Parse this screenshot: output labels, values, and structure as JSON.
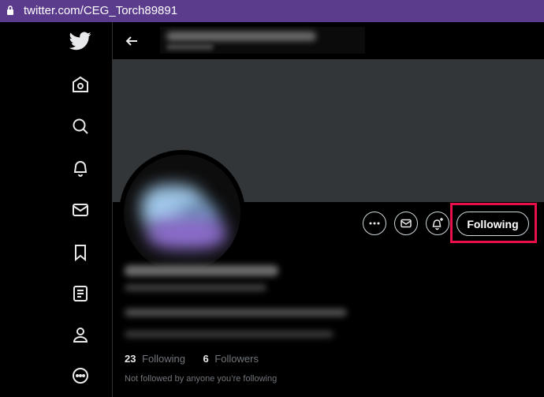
{
  "browser": {
    "url": "twitter.com/CEG_Torch89891"
  },
  "sidebar": {
    "items": [
      {
        "icon": "twitter-bird-icon"
      },
      {
        "icon": "home-icon"
      },
      {
        "icon": "search-icon"
      },
      {
        "icon": "bell-icon"
      },
      {
        "icon": "mail-icon"
      },
      {
        "icon": "bookmark-icon"
      },
      {
        "icon": "list-icon"
      },
      {
        "icon": "profile-icon"
      },
      {
        "icon": "more-icon"
      }
    ]
  },
  "profile": {
    "actions": {
      "more_icon": "more-horizontal-icon",
      "message_icon": "mail-icon",
      "notify_icon": "bell-plus-icon",
      "follow_label": "Following"
    },
    "stats": {
      "following_count": "23",
      "following_label": "Following",
      "followers_count": "6",
      "followers_label": "Followers"
    },
    "followed_by_note": "Not followed by anyone you’re following"
  },
  "colors": {
    "browser_bar": "#5b3b8c",
    "highlight": "#e8104a",
    "banner": "#333639"
  }
}
